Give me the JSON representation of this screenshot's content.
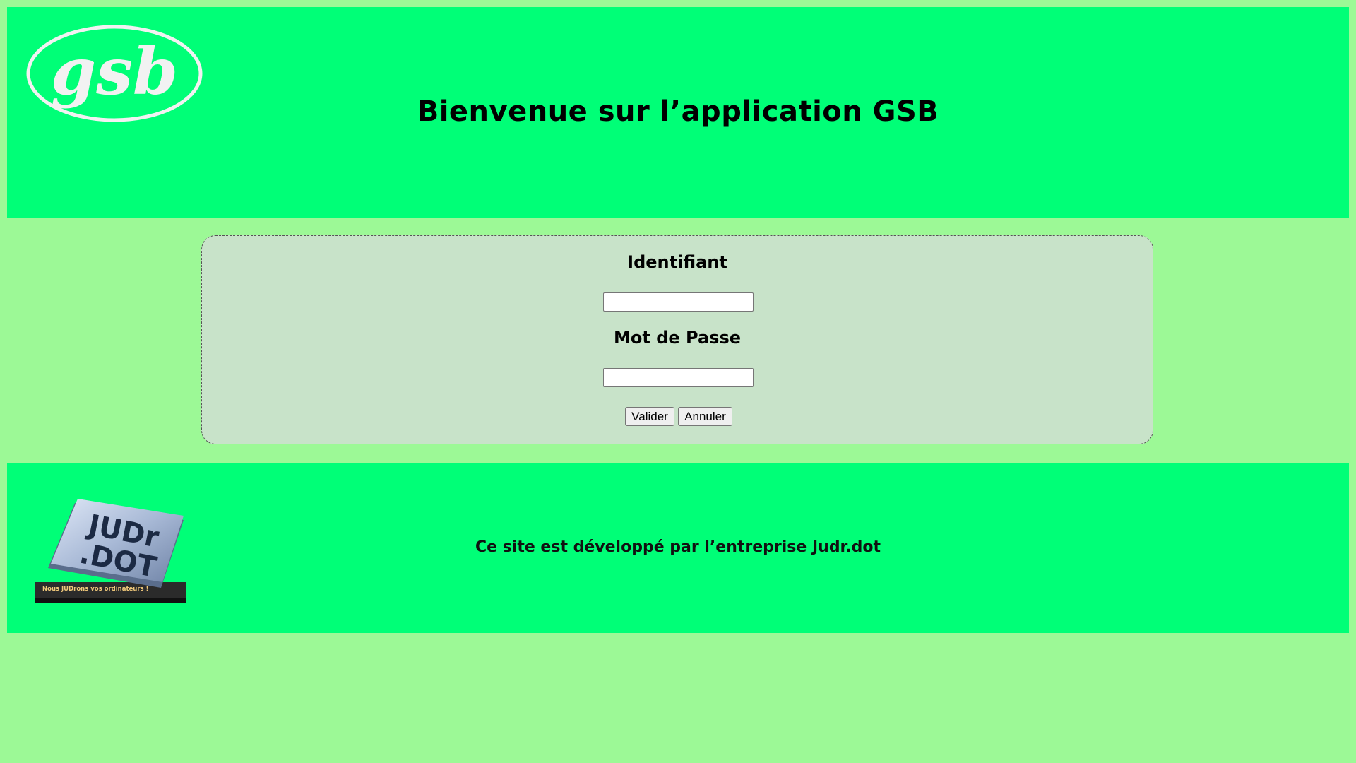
{
  "header": {
    "logo_text": "gsb",
    "title": "Bienvenue sur l’application GSB"
  },
  "login": {
    "username_label": "Identifiant",
    "username_value": "",
    "password_label": "Mot de Passe",
    "password_value": "",
    "submit_label": "Valider",
    "cancel_label": "Annuler"
  },
  "footer": {
    "logo_text_line1": "JUDr",
    "logo_text_line2": ".DOT",
    "logo_tagline": "Nous JUDrons vos ordinateurs !",
    "text": "Ce site est développé par l’entreprise Judr.dot"
  },
  "colors": {
    "page_background": "#9cf996",
    "banner_background": "#00ff77",
    "login_box_background": "#c8e3c9"
  },
  "icons": {
    "header_logo": "gsb-logo",
    "footer_logo": "judr-dot-logo"
  }
}
